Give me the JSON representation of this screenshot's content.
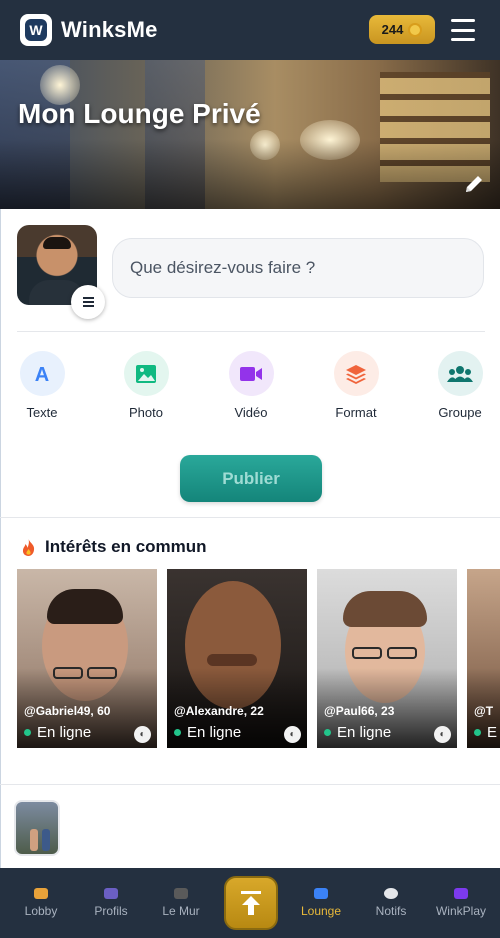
{
  "header": {
    "brand": "WinksMe",
    "logo_letter": "W",
    "coins": "244"
  },
  "banner": {
    "title": "Mon Lounge Privé"
  },
  "composer": {
    "placeholder": "Que désirez-vous faire ?"
  },
  "post_types": [
    {
      "label": "Texte",
      "icon": "text-icon",
      "color": "#3b82f6",
      "bg": "#e8f1fd"
    },
    {
      "label": "Photo",
      "icon": "image-icon",
      "color": "#10b981",
      "bg": "#e3f6ef"
    },
    {
      "label": "Vidéo",
      "icon": "video-icon",
      "color": "#9333ea",
      "bg": "#f1e7fb"
    },
    {
      "label": "Format",
      "icon": "layers-icon",
      "color": "#f0643c",
      "bg": "#fdece6"
    },
    {
      "label": "Groupe",
      "icon": "users-icon",
      "color": "#0f766e",
      "bg": "#e3f2f1"
    }
  ],
  "publish_label": "Publier",
  "interests": {
    "title": "Intérêts en commun",
    "profiles": [
      {
        "handle": "@Gabriel49, 60",
        "status": "En ligne"
      },
      {
        "handle": "@Alexandre, 22",
        "status": "En ligne"
      },
      {
        "handle": "@Paul66, 23",
        "status": "En ligne"
      },
      {
        "handle": "@T",
        "status": "E"
      }
    ]
  },
  "bottom_nav": [
    {
      "label": "Lobby",
      "icon": "house-icon"
    },
    {
      "label": "Profils",
      "icon": "people-icon"
    },
    {
      "label": "Le Mur",
      "icon": "wall-icon"
    },
    {
      "label": "Lounge",
      "icon": "sofa-icon",
      "active": true
    },
    {
      "label": "Notifs",
      "icon": "chat-bubble-icon"
    },
    {
      "label": "WinkPlay",
      "icon": "gamepad-icon"
    }
  ],
  "colors": {
    "topbar": "#243040",
    "accent_gold": "#e8b93a",
    "publish_teal": "#14857a",
    "online_green": "#22c58b"
  }
}
